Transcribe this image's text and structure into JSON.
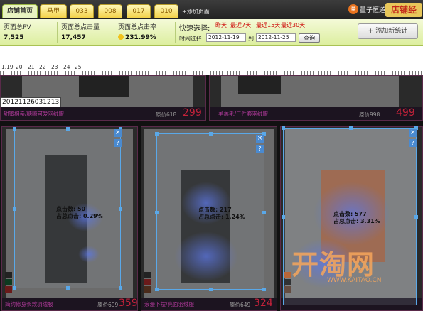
{
  "tabs": [
    {
      "label": "店铺首页",
      "active": true
    },
    {
      "label": "马甲"
    },
    {
      "label": "033"
    },
    {
      "label": "008"
    },
    {
      "label": "017"
    },
    {
      "label": "010"
    }
  ],
  "add_tab_label": "添加页面",
  "brand": {
    "logo": "量",
    "name": "量子恒道",
    "tag": "店铺经"
  },
  "stats": {
    "pv_label": "页面总PV",
    "pv_value": "7,525",
    "clicks_label": "页面总点击量",
    "clicks_value": "17,457",
    "rate_label": "页面总点击率",
    "rate_value": "231.99%"
  },
  "quick": {
    "label": "快速选择:",
    "options": [
      "昨天",
      "最近7天",
      "最近15天",
      "最近30天"
    ],
    "time_label": "时间选择:",
    "start_date": "2012-11-19",
    "to_label": "到",
    "end_date": "2012-11-25",
    "query_label": "查询"
  },
  "add_stat_label": "添加新统计",
  "ruler": [
    "1.19",
    "20",
    "21",
    "22",
    "23",
    "24",
    "25"
  ],
  "date_stamp": "20121126031213",
  "top_products": [
    {
      "title": "甜蜜相亲/糖糖可爱羽绒服",
      "orig": "原价618",
      "price": "299"
    },
    {
      "title": "羊羔毛/三件套羽绒服",
      "orig": "原价998",
      "price": "499"
    }
  ],
  "products": [
    {
      "title": "简约修身长款羽绒服",
      "orig": "原价699",
      "price": "359",
      "clicks": "点击数: 50",
      "ratio": "占总点击: 0.29%"
    },
    {
      "title": "浪漫下摆/亮面羽绒服",
      "orig": "原价649",
      "price": "324",
      "clicks": "点击数: 217",
      "ratio": "占总点击: 1.24%"
    },
    {
      "title": "",
      "orig": "",
      "price": "",
      "clicks": "点击数: 577",
      "ratio": "占总点击: 3.31%"
    }
  ],
  "watermark": {
    "text": "开淘网",
    "url": "WWW.KAITAO.CN"
  },
  "colors": {
    "accent": "#a9c254",
    "price": "#c4223a",
    "overlay": "#5aa8e8"
  }
}
